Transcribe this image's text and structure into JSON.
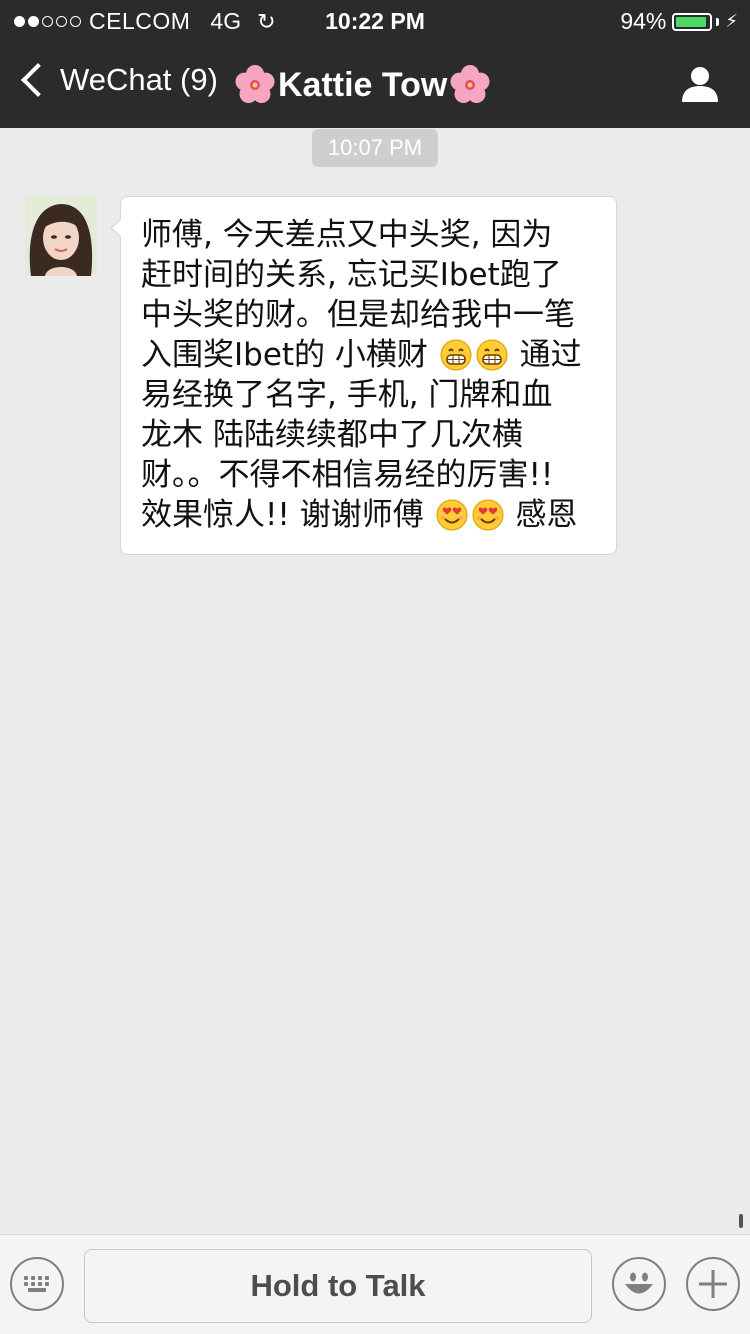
{
  "status_bar": {
    "carrier": "CELCOM",
    "network": "4G",
    "time": "10:22 PM",
    "battery_percent": "94%",
    "battery_level": 0.94,
    "signal_bars": 2,
    "signal_total": 5,
    "battery_color": "#4cd964"
  },
  "nav": {
    "back_label": "WeChat (9)",
    "contact_name": "Kattie Tow",
    "title_decoration_icon": "cherry-blossom-icon",
    "profile_icon": "person-icon"
  },
  "chat": {
    "timestamp": "10:07 PM",
    "message": {
      "lines": [
        "师傅, 今天差点又中头奖, 因为",
        "赶时间的关系, 忘记买Ibet跑了",
        "中头奖的财。但是却给我中一笔"
      ],
      "line4_text": "入围奖Ibet的 小横财",
      "line4_tail": "通过",
      "lines_mid": [
        "易经换了名字, 手机, 门牌和血",
        "龙木 陆陆续续都中了几次横",
        "财。。不得不相信易经的厉害!!"
      ],
      "line8_text": "效果惊人!! 谢谢师傅",
      "line8_tail": "感恩",
      "emoji_1": "grinning-face-icon",
      "emoji_2": "smiling-heart-eyes-face-icon"
    }
  },
  "input_bar": {
    "hold_to_talk_label": "Hold to Talk",
    "keyboard_icon": "keyboard-icon",
    "emoji_icon": "smiley-face-icon",
    "plus_icon": "plus-icon"
  }
}
